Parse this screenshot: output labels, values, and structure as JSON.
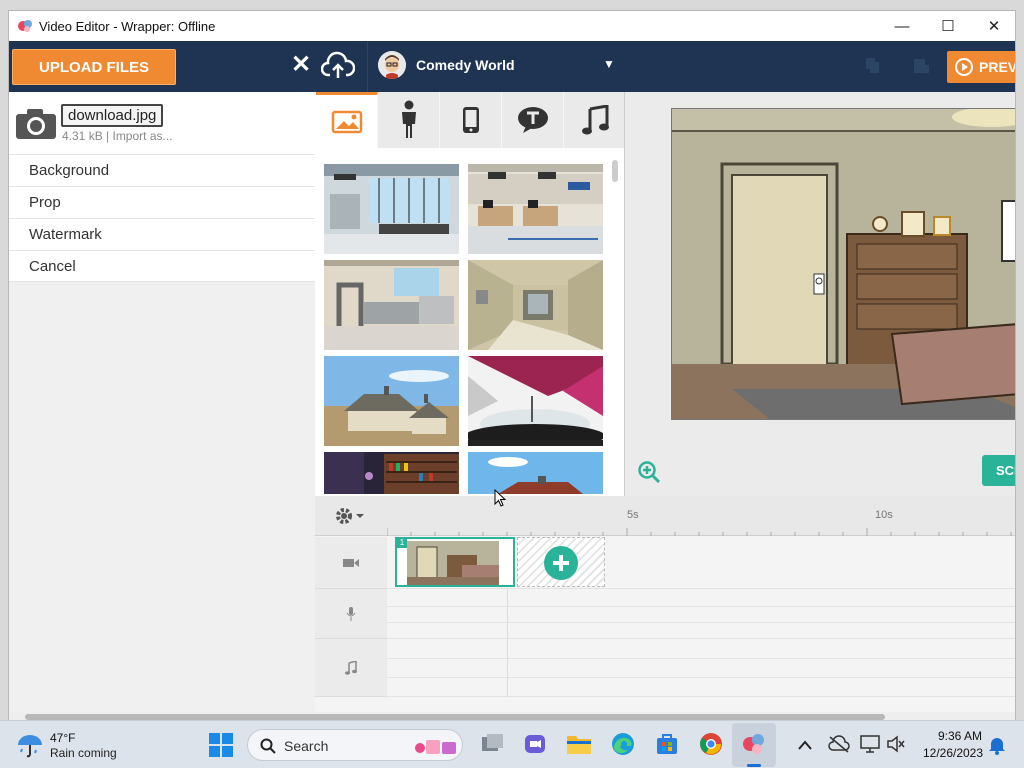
{
  "window": {
    "title": "Video Editor - Wrapper: Offline",
    "minimize": "—",
    "maximize": "☐",
    "close": "✕"
  },
  "topbar": {
    "upload_label": "UPLOAD FILES",
    "close_symbol": "✕",
    "profile_name": "Comedy World",
    "preview_label": "PREV"
  },
  "upload_panel": {
    "file_name": "download.jpg",
    "file_meta": "4.31 kB | Import as...",
    "options": [
      "Background",
      "Prop",
      "Watermark",
      "Cancel"
    ]
  },
  "asset_tabs": [
    "background-tab",
    "character-tab",
    "prop-tab",
    "text-tab",
    "sound-tab"
  ],
  "thumbnails": [
    "airport-terminal",
    "airport-checkin",
    "security-checkpoint",
    "airplane-cabin",
    "farm-house",
    "stage-spotlights",
    "library-night",
    "barn-sky"
  ],
  "stage": {
    "scene_button": "SCE"
  },
  "timeline": {
    "ticks": [
      "5s",
      "10s"
    ],
    "scene_number": "1"
  },
  "taskbar": {
    "weather_temp": "47°F",
    "weather_desc": "Rain coming",
    "search_placeholder": "Search",
    "time": "9:36 AM",
    "date": "12/26/2023"
  },
  "colors": {
    "accent": "#f08a32",
    "topbar": "#1f3452",
    "teal": "#2bb39a"
  }
}
